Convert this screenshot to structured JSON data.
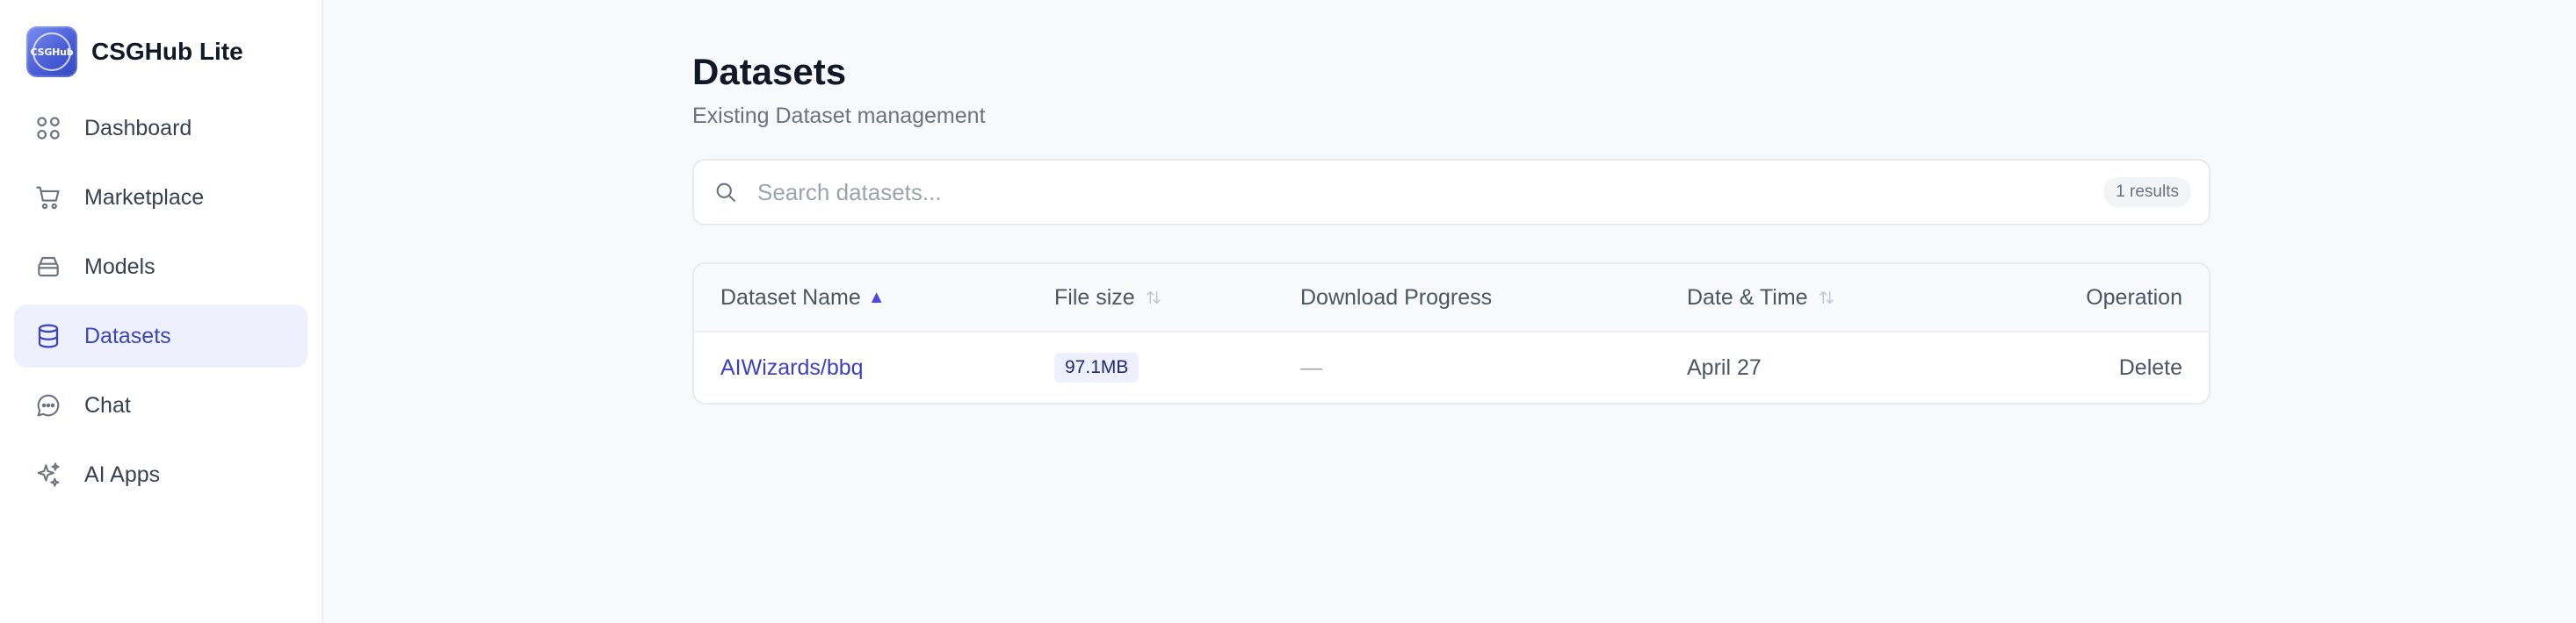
{
  "brand": {
    "name": "CSGHub Lite",
    "logo_text": "CSGHub"
  },
  "sidebar": {
    "items": [
      {
        "label": "Dashboard",
        "icon": "grid-icon"
      },
      {
        "label": "Marketplace",
        "icon": "cart-icon"
      },
      {
        "label": "Models",
        "icon": "box-icon"
      },
      {
        "label": "Datasets",
        "icon": "database-icon",
        "active": true
      },
      {
        "label": "Chat",
        "icon": "chat-icon"
      },
      {
        "label": "AI Apps",
        "icon": "sparkles-icon"
      }
    ]
  },
  "page": {
    "title": "Datasets",
    "subtitle": "Existing Dataset management"
  },
  "search": {
    "placeholder": "Search datasets...",
    "results": "1 results"
  },
  "table": {
    "headers": {
      "name": "Dataset Name",
      "size": "File size",
      "progress": "Download Progress",
      "date": "Date & Time",
      "operation": "Operation"
    },
    "rows": [
      {
        "name": "AIWizards/bbq",
        "size": "97.1MB",
        "progress": "—",
        "date": "April 27",
        "operation": "Delete"
      }
    ]
  },
  "colors": {
    "accent": "#4f46e5",
    "active_bg": "#eef0fd",
    "link": "#3d3fc4"
  }
}
